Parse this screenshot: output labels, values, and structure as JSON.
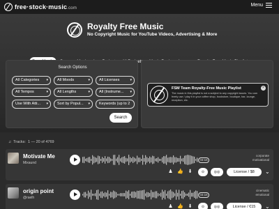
{
  "site": {
    "logo_text": "free·stock·music",
    "logo_tld": ".com",
    "menu_label": "Menu"
  },
  "hero": {
    "title": "Royalty Free Music",
    "subtitle": "No Copyright Music for YouTube Videos, Advertising & More"
  },
  "nav": {
    "items": [
      {
        "label": "Free Music",
        "active": true
      },
      {
        "label": "Summer Music"
      },
      {
        "label": "Low Budget"
      },
      {
        "label": "All Budgets"
      },
      {
        "label": "Music Packs"
      },
      {
        "label": "Loops"
      },
      {
        "label": "Royalty Free Music Playlists"
      }
    ]
  },
  "search_panel": {
    "title": "Search Options",
    "filters": [
      "All Categories",
      "All Moods",
      "All Licenses",
      "All Tempos",
      "All Lengths",
      "All (Instrume...",
      "Use With Atti...",
      "Sort by Popul...",
      "Keywords (up to 2"
    ],
    "search_label": "Search"
  },
  "playlist_card": {
    "title": "FSM Team Royalty-Free Music Playlist",
    "description": "The music in this playlist is not a subject to any copyright issues. You can freely use / play it in your coffee shop, bookstore, boutique, bar, lounge, reception, etc."
  },
  "tracks_header": {
    "label": "Tracks:",
    "range": "1 — 20 of 4769"
  },
  "tracks": [
    {
      "title": "Motivate Me",
      "artist": "Mixaund",
      "duration": "03:16",
      "tags": [
        "corporate",
        "motivational"
      ],
      "license_label": "License / $8"
    },
    {
      "title": "origin point",
      "artist": "@raelh",
      "duration": "03:16",
      "tags": [
        "cinematic",
        "emotional"
      ],
      "license_label": "License / €15"
    }
  ],
  "icons": {
    "music_note": "music-note-icon",
    "person": "person-icon",
    "thumb_up": "thumb-up-icon",
    "download": "download-icon",
    "chevron": "chevron-down-icon"
  },
  "colors": {
    "background": "#2b2b2b",
    "topbar": "#1c1c1c",
    "panel": "#3a3a3a",
    "accent": "#ffffff"
  }
}
